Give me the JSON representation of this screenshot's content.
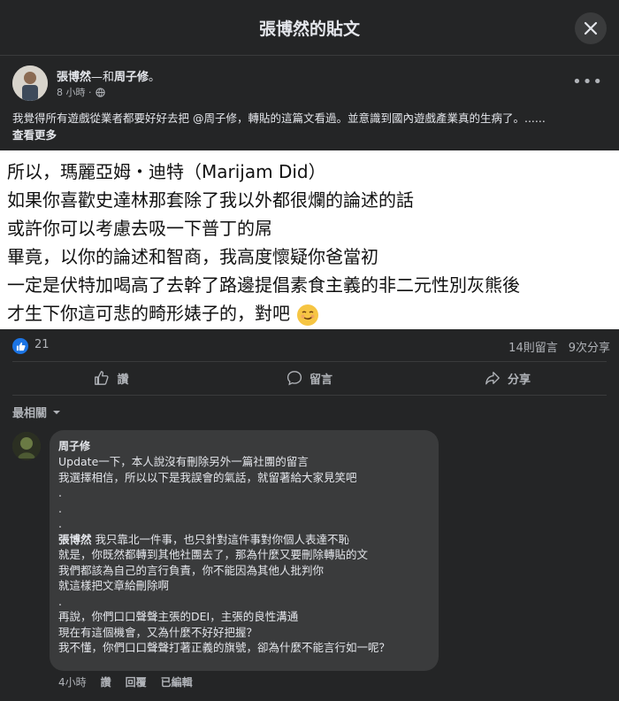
{
  "modal": {
    "title": "張博然的貼文"
  },
  "post": {
    "author": "張博然",
    "with_text": "—和",
    "tagged": "周子修",
    "period": "。",
    "time": "8 小時 ·",
    "text": "我覺得所有遊戲從業者都要好好去把 @周子修，轉貼的這篇文看過。並意識到國內遊戲產業真的生病了。......",
    "see_more": "查看更多",
    "image_lines": [
      "所以，瑪麗亞姆・迪特（Marijam Did）",
      "如果你喜歡史達林那套除了我以外都很爛的論述的話",
      "或許你可以考慮去吸一下普丁的屌",
      "畢竟，以你的論述和智商，我高度懷疑你爸當初",
      "一定是伏特加喝高了去幹了路邊提倡素食主義的非二元性別灰熊後",
      "才生下你這可悲的畸形婊子的，對吧"
    ],
    "reaction_count": "21",
    "comment_count": "14則留言",
    "share_count": "9次分享"
  },
  "actions": {
    "like": "讚",
    "comment": "留言",
    "share": "分享"
  },
  "sort": {
    "label": "最相關"
  },
  "comment": {
    "author": "周子修",
    "lines": [
      "Update一下，本人說沒有刪除另外一篇社團的留言",
      "我選擇相信，所以以下是我誤會的氣話，就留著給大家見笑吧",
      ".",
      ".",
      ".",
      "",
      "我們都該為自己的言行負責，你不能因為其他人批判你",
      "就這樣把文章給刪除啊",
      ".",
      "再說，你們口口聲聲主張的DEI，主張的良性溝通",
      "現在有這個機會，又為什麼不好好把握？",
      "我不懂，你們口口聲聲打著正義的旗號，卻為什麼不能言行如一呢？"
    ],
    "mention": "張博然",
    "mention_rest": " 我只靠北一件事，也只針對這件事對你個人表達不恥",
    "line_after_mention": "就是，你既然都轉到其他社團去了，那為什麼又要刪除轉貼的文",
    "time": "4小時",
    "like": "讚",
    "reply": "回覆",
    "edited": "已編輯"
  },
  "colors": {
    "background": "#242526",
    "bubble": "#3a3b3c",
    "like_blue": "#1b74e4",
    "muted_text": "#b0b3b8"
  },
  "icons": [
    "close-icon",
    "globe-icon",
    "more-icon",
    "like-reaction-icon",
    "thumbs-up-icon",
    "comment-icon",
    "share-icon",
    "chevron-down-icon",
    "emoji-icon"
  ]
}
